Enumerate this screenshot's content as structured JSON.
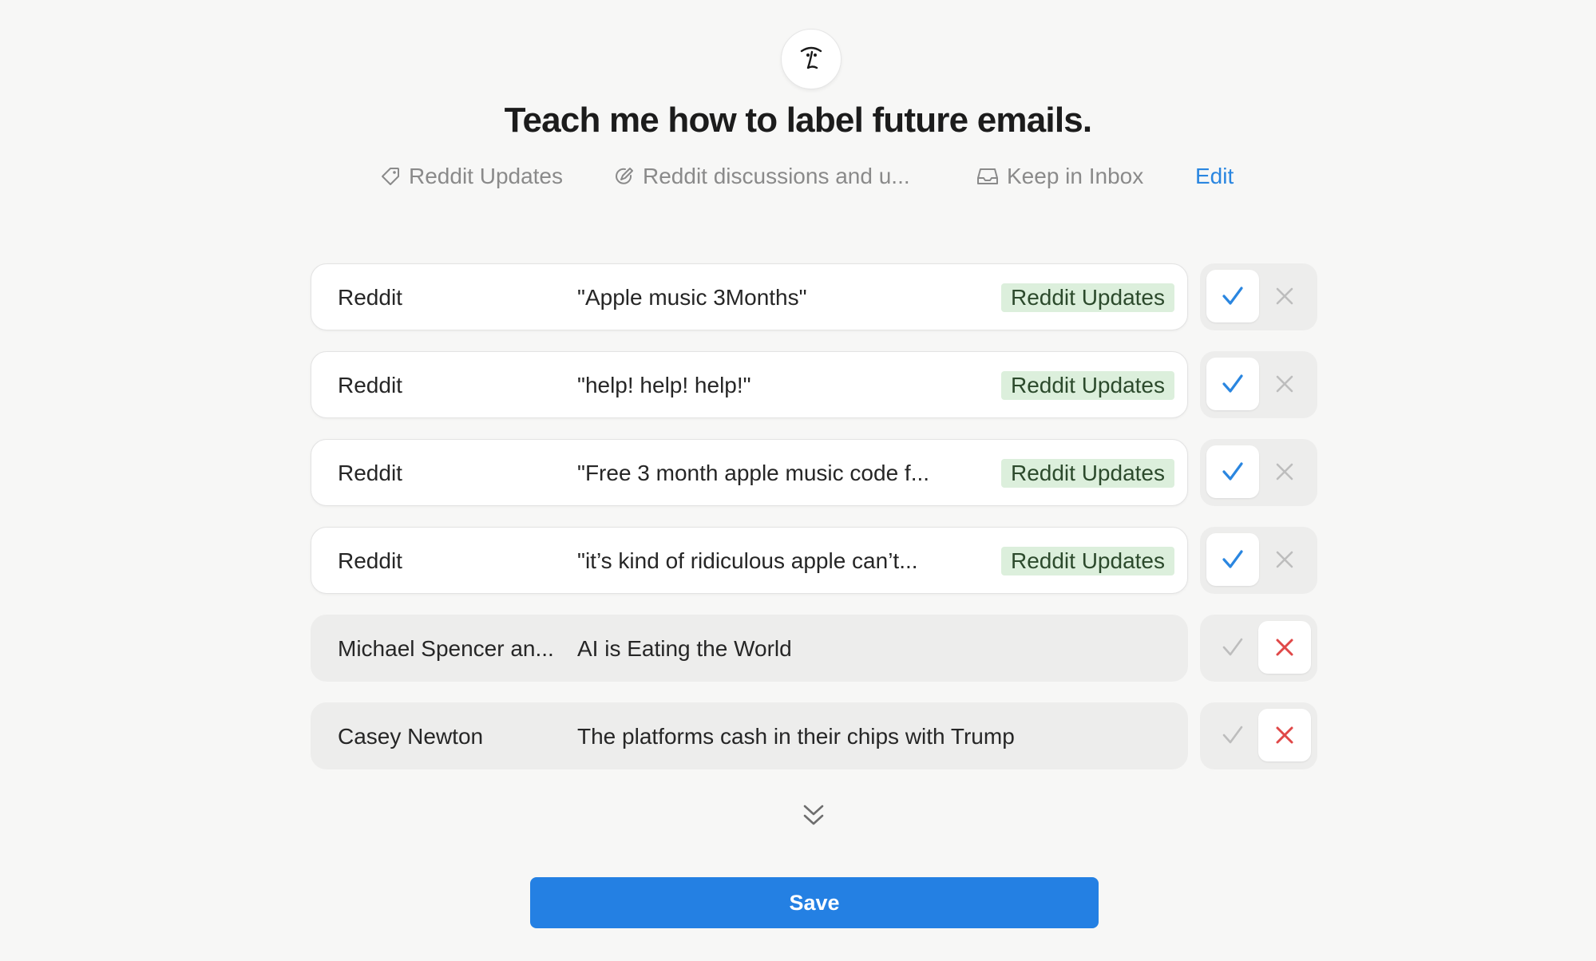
{
  "header": {
    "title": "Teach me how to label future emails."
  },
  "rule": {
    "label_name": "Reddit Updates",
    "description": "Reddit discussions and u...",
    "action": "Keep in Inbox",
    "edit_label": "Edit"
  },
  "emails": [
    {
      "sender": "Reddit",
      "subject": "\"Apple music 3Months\"",
      "label": "Reddit Updates",
      "status": "accepted"
    },
    {
      "sender": "Reddit",
      "subject": "\"help! help! help!\"",
      "label": "Reddit Updates",
      "status": "accepted"
    },
    {
      "sender": "Reddit",
      "subject": "\"Free 3 month apple music code f...",
      "label": "Reddit Updates",
      "status": "accepted"
    },
    {
      "sender": "Reddit",
      "subject": "\"it’s kind of ridiculous apple can’t...",
      "label": "Reddit Updates",
      "status": "accepted"
    },
    {
      "sender": "Michael Spencer an...",
      "subject": "AI is Eating the World",
      "label": "",
      "status": "rejected"
    },
    {
      "sender": "Casey Newton",
      "subject": "The platforms cash in their chips with Trump",
      "label": "",
      "status": "rejected"
    }
  ],
  "footer": {
    "save_label": "Save"
  },
  "colors": {
    "accent": "#2480e3",
    "check_active": "#2a86e0",
    "cross_active": "#e04848",
    "inactive_icon": "#bdbdbd",
    "label_bg": "#dcefdc"
  },
  "icons": {
    "logo": "assistant-face-icon",
    "label": "tag-icon",
    "description": "pen-circle-icon",
    "action": "inbox-tray-icon",
    "accept": "check-icon",
    "reject": "x-icon",
    "more": "double-chevron-down-icon"
  }
}
